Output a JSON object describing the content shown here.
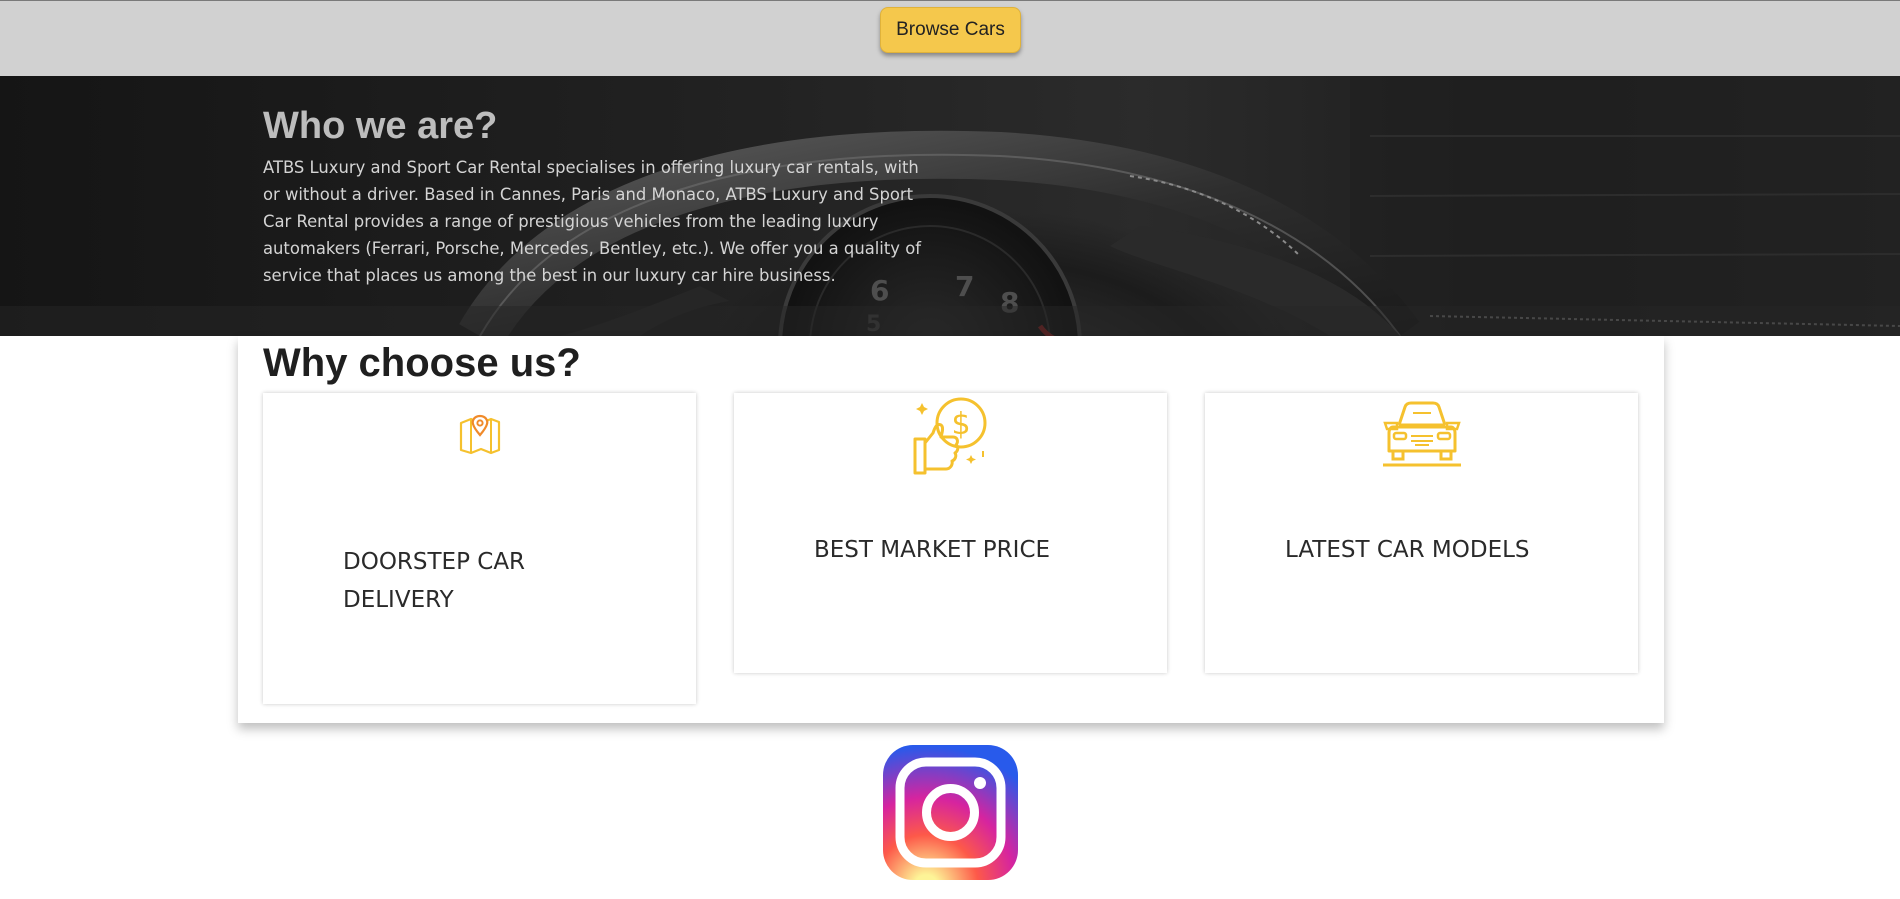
{
  "topbar": {
    "browse_label": "Browse Cars",
    "button_color": "#f5c84c"
  },
  "hero": {
    "title": "Who we are?",
    "text": "ATBS Luxury and Sport Car Rental specialises in offering luxury car rentals, with or without a driver. Based in Cannes, Paris and Monaco, ATBS Luxury and Sport Car Rental provides a range of prestigious vehicles from the leading luxury automakers (Ferrari, Porsche, Mercedes, Bentley, etc.). We offer you a quality of service that places us among the best in our luxury car hire business.",
    "gauge_numbers": [
      "5",
      "6",
      "7",
      "8"
    ]
  },
  "why": {
    "title": "Why choose us?",
    "cards": [
      {
        "icon": "map-pin-icon",
        "label": "DOORSTEP CAR DELIVERY"
      },
      {
        "icon": "thumbs-up-dollar-icon",
        "label": "BEST MARKET PRICE"
      },
      {
        "icon": "car-front-icon",
        "label": "LATEST CAR MODELS"
      }
    ],
    "accent_color": "#f5c12e"
  },
  "footer": {
    "social_icon": "instagram-icon"
  }
}
